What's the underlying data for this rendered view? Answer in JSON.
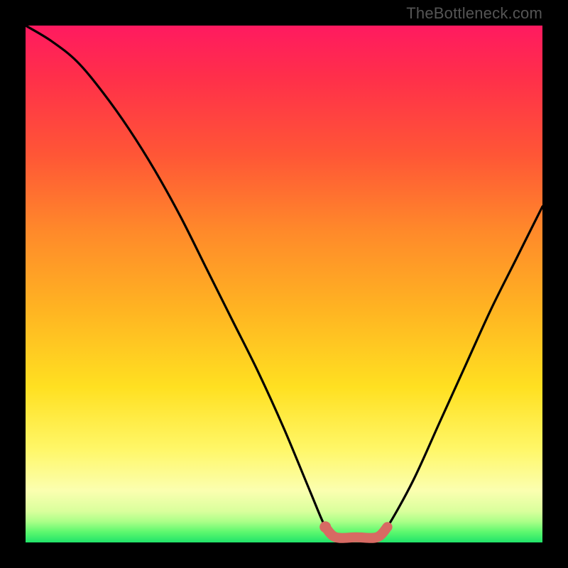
{
  "watermark": "TheBottleneck.com",
  "colors": {
    "frame": "#000000",
    "curve": "#000000",
    "highlight": "#d76a63"
  },
  "chart_data": {
    "type": "line",
    "title": "",
    "xlabel": "",
    "ylabel": "",
    "xlim": [
      0,
      100
    ],
    "ylim": [
      0,
      100
    ],
    "series": [
      {
        "name": "bottleneck-curve",
        "x": [
          0,
          5,
          10,
          15,
          20,
          25,
          30,
          35,
          40,
          45,
          50,
          55,
          58,
          60,
          64,
          68,
          70,
          75,
          80,
          85,
          90,
          95,
          100
        ],
        "y": [
          100,
          97,
          93,
          87,
          80,
          72,
          63,
          53,
          43,
          33,
          22,
          10,
          3,
          1,
          1,
          1,
          3,
          12,
          23,
          34,
          45,
          55,
          65
        ]
      }
    ],
    "highlight": {
      "name": "optimal-zone",
      "x": [
        58,
        60,
        64,
        68,
        70
      ],
      "y": [
        3,
        1,
        1,
        1,
        3
      ]
    },
    "legend": false,
    "grid": false
  }
}
